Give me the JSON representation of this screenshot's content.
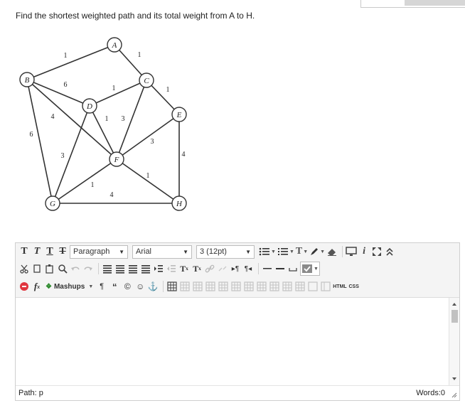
{
  "question": "Find the shortest weighted path and its total weight from A to H.",
  "graph": {
    "nodes": [
      {
        "id": "A",
        "label": "A"
      },
      {
        "id": "B",
        "label": "B"
      },
      {
        "id": "C",
        "label": "C"
      },
      {
        "id": "D",
        "label": "D"
      },
      {
        "id": "E",
        "label": "E"
      },
      {
        "id": "F",
        "label": "F"
      },
      {
        "id": "G",
        "label": "G"
      },
      {
        "id": "H",
        "label": "H"
      }
    ],
    "edges": [
      {
        "from": "B",
        "to": "A",
        "weight": "1"
      },
      {
        "from": "A",
        "to": "C",
        "weight": "1"
      },
      {
        "from": "B",
        "to": "D",
        "weight": "6"
      },
      {
        "from": "D",
        "to": "C",
        "weight": "1"
      },
      {
        "from": "C",
        "to": "E",
        "weight": "1"
      },
      {
        "from": "B",
        "to": "G",
        "weight": "6"
      },
      {
        "from": "B",
        "to": "F",
        "weight": "4"
      },
      {
        "from": "D",
        "to": "G",
        "weight": "3"
      },
      {
        "from": "D",
        "to": "F",
        "weight": "1"
      },
      {
        "from": "C",
        "to": "F",
        "weight": "3"
      },
      {
        "from": "F",
        "to": "E",
        "weight": "3"
      },
      {
        "from": "E",
        "to": "H",
        "weight": "4"
      },
      {
        "from": "F",
        "to": "G",
        "weight": "1"
      },
      {
        "from": "G",
        "to": "H",
        "weight": "4"
      },
      {
        "from": "F",
        "to": "H",
        "weight": "1"
      }
    ]
  },
  "toolbar": {
    "format_select": "Paragraph",
    "font_select": "Arial",
    "size_select": "3 (12pt)",
    "mashups_label": "Mashups",
    "html_label": "HTML",
    "css_label": "CSS"
  },
  "status": {
    "path": "Path: p",
    "words": "Words:0"
  }
}
